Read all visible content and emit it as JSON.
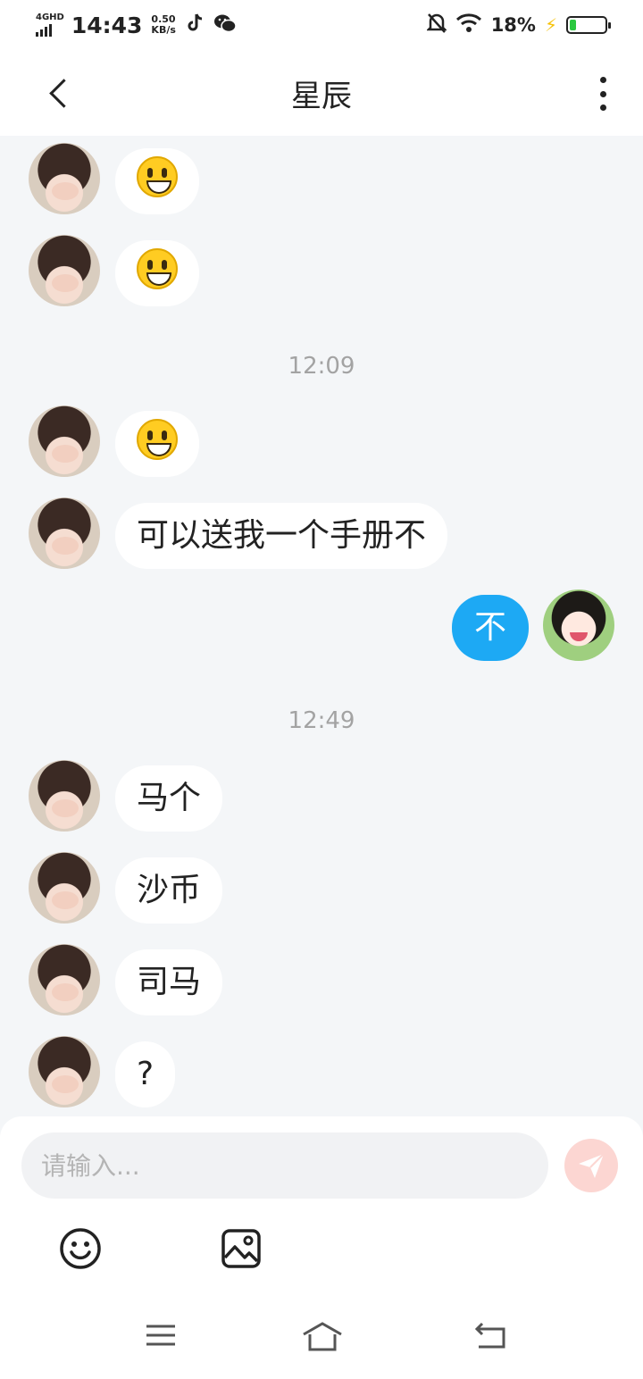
{
  "status_bar": {
    "network": "4GHD",
    "time": "14:43",
    "speed_value": "0.50",
    "speed_unit": "KB/s",
    "battery_percent": "18%",
    "battery_level": 0.18,
    "battery_color": "#2bc840",
    "icons": [
      "tiktok-icon",
      "wechat-icon",
      "mute-bell-icon",
      "wifi-icon",
      "charging-bolt-icon",
      "battery-icon"
    ]
  },
  "header": {
    "title": "星辰",
    "back_icon": "chevron-left-icon",
    "more_icon": "more-vertical-icon"
  },
  "messages": [
    {
      "side": "them",
      "type": "emoji",
      "emoji": "smiley-face"
    },
    {
      "side": "them",
      "type": "emoji",
      "emoji": "smiley-face"
    },
    {
      "type": "time",
      "text": "12:09"
    },
    {
      "side": "them",
      "type": "emoji",
      "emoji": "smiley-face"
    },
    {
      "side": "them",
      "type": "text",
      "text": "可以送我一个手册不"
    },
    {
      "side": "me",
      "type": "text",
      "text": "不"
    },
    {
      "type": "time",
      "text": "12:49"
    },
    {
      "side": "them",
      "type": "text",
      "text": "马个"
    },
    {
      "side": "them",
      "type": "text",
      "text": "沙币"
    },
    {
      "side": "them",
      "type": "text",
      "text": "司马"
    },
    {
      "side": "them",
      "type": "text",
      "text": "?"
    }
  ],
  "composer": {
    "placeholder": "请输入...",
    "value": "",
    "send_icon": "send-icon",
    "tools": [
      "emoji-icon",
      "image-icon"
    ]
  },
  "colors": {
    "my_bubble": "#1da9f4",
    "their_bubble": "#ffffff",
    "chat_background": "#f4f6f8",
    "send_button": "#fcd6d2"
  },
  "nav_bar": [
    "menu-icon",
    "home-icon",
    "back-icon"
  ]
}
